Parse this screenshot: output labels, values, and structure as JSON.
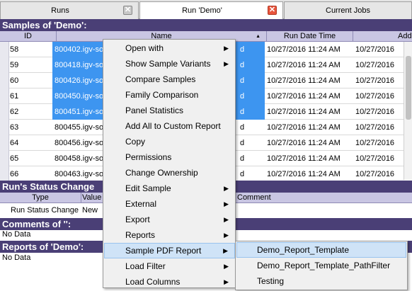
{
  "tabs": [
    {
      "label": "Runs",
      "active": false
    },
    {
      "label": "Run 'Demo'",
      "active": true
    },
    {
      "label": "Current Jobs",
      "active": false
    }
  ],
  "samples": {
    "title": "Samples of 'Demo':",
    "columns": [
      "ID",
      "Name",
      "Run Date Time",
      "Add"
    ],
    "rows": [
      {
        "id": "58",
        "name": "800402.igv-so",
        "name_tail": "d",
        "date": "10/27/2016 11:24 AM",
        "date2": "10/27/2016",
        "selected": true
      },
      {
        "id": "59",
        "name": "800418.igv-so",
        "name_tail": "d",
        "date": "10/27/2016 11:24 AM",
        "date2": "10/27/2016",
        "selected": true
      },
      {
        "id": "60",
        "name": "800426.igv-so",
        "name_tail": "d",
        "date": "10/27/2016 11:24 AM",
        "date2": "10/27/2016",
        "selected": true
      },
      {
        "id": "61",
        "name": "800450.igv-so",
        "name_tail": "d",
        "date": "10/27/2016 11:24 AM",
        "date2": "10/27/2016",
        "selected": true
      },
      {
        "id": "62",
        "name": "800451.igv-so",
        "name_tail": "d",
        "date": "10/27/2016 11:24 AM",
        "date2": "10/27/2016",
        "selected": true
      },
      {
        "id": "63",
        "name": "800455.igv-so",
        "name_tail": "d",
        "date": "10/27/2016 11:24 AM",
        "date2": "10/27/2016",
        "selected": false
      },
      {
        "id": "64",
        "name": "800456.igv-so",
        "name_tail": "d",
        "date": "10/27/2016 11:24 AM",
        "date2": "10/27/2016",
        "selected": false
      },
      {
        "id": "65",
        "name": "800458.igv-so",
        "name_tail": "d",
        "date": "10/27/2016 11:24 AM",
        "date2": "10/27/2016",
        "selected": false
      },
      {
        "id": "66",
        "name": "800463.igv-so",
        "name_tail": "d",
        "date": "10/27/2016 11:24 AM",
        "date2": "10/27/2016",
        "selected": false
      }
    ]
  },
  "status": {
    "title": "Run's Status Change",
    "columns": [
      "Type",
      "Value",
      "Comment"
    ],
    "row": {
      "type": "Run Status Change",
      "value": "New"
    }
  },
  "comments": {
    "title": "Comments of '':",
    "empty": "No Data"
  },
  "reports": {
    "title": "Reports of 'Demo':",
    "empty": "No Data"
  },
  "context_menu": {
    "items": [
      {
        "label": "Open with",
        "submenu": true
      },
      {
        "label": "Show Sample Variants",
        "submenu": true
      },
      {
        "label": "Compare Samples",
        "submenu": false
      },
      {
        "label": "Family Comparison",
        "submenu": false
      },
      {
        "label": "Panel Statistics",
        "submenu": false
      },
      {
        "label": "Add All to Custom Report",
        "submenu": false
      },
      {
        "label": "Copy",
        "submenu": false
      },
      {
        "label": "Permissions",
        "submenu": false
      },
      {
        "label": "Change Ownership",
        "submenu": false
      },
      {
        "label": "Edit Sample",
        "submenu": true
      },
      {
        "label": "External",
        "submenu": true
      },
      {
        "label": "Export",
        "submenu": true
      },
      {
        "label": "Reports",
        "submenu": true
      },
      {
        "label": "Sample PDF Report",
        "submenu": true,
        "highlighted": true
      },
      {
        "label": "Load Filter",
        "submenu": true
      },
      {
        "label": "Load Columns",
        "submenu": true
      }
    ],
    "submenu_arrow": "▶"
  },
  "pdf_submenu": {
    "items": [
      {
        "label": "Demo_Report_Template",
        "highlighted": true
      },
      {
        "label": "Demo_Report_Template_PathFilter"
      },
      {
        "label": "Testing"
      }
    ]
  },
  "icons": {
    "tab_close": "✕",
    "sort_arrow": "▲"
  }
}
